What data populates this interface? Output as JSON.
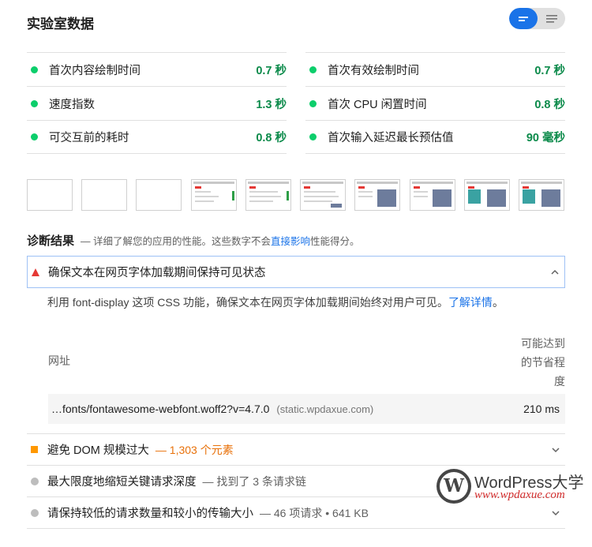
{
  "lab": {
    "title": "实验室数据",
    "view_toggle": {
      "active": "list-view-icon",
      "inactive": "text-view-icon"
    }
  },
  "metrics": {
    "left": [
      {
        "label": "首次内容绘制时间",
        "value": "0.7 秒",
        "status": "pass"
      },
      {
        "label": "速度指数",
        "value": "1.3 秒",
        "status": "pass"
      },
      {
        "label": "可交互前的耗时",
        "value": "0.8 秒",
        "status": "pass"
      }
    ],
    "right": [
      {
        "label": "首次有效绘制时间",
        "value": "0.7 秒",
        "status": "pass"
      },
      {
        "label": "首次 CPU 闲置时间",
        "value": "0.8 秒",
        "status": "pass"
      },
      {
        "label": "首次输入延迟最长预估值",
        "value": "90 毫秒",
        "status": "pass"
      }
    ],
    "colors": {
      "pass": "#0cce6b",
      "pass_text": "#0b8a4a",
      "warn": "#ff9800",
      "fail": "#e53935",
      "link": "#1a73e8"
    }
  },
  "filmstrip": {
    "frame_count": 10,
    "blank_frames": 3
  },
  "diagnostics": {
    "title": "诊断结果",
    "desc_prefix": "— 详细了解您的应用的性能。这些数字不会",
    "desc_link": "直接影响",
    "desc_suffix": "性能得分。",
    "open_audit": {
      "title": "确保文本在网页字体加载期间保持可见状态",
      "body_text": "利用 font-display 这项 CSS 功能，确保文本在网页字体加载期间始终对用户可见。",
      "body_link": "了解详情",
      "body_end": "。",
      "table": {
        "col_url": "网址",
        "col_savings": "可能达到的节省程度",
        "rows": [
          {
            "url": "…fonts/fontawesome-webfont.woff2?v=4.7.0",
            "host": "(static.wpdaxue.com)",
            "value": "210 ms"
          }
        ]
      }
    },
    "audits": [
      {
        "title": "避免 DOM 规模过大",
        "sub": "— 1,303 个元素",
        "kind": "warn"
      },
      {
        "title": "最大限度地缩短关键请求深度",
        "sub": "— 找到了 3 条请求链",
        "kind": "info"
      },
      {
        "title": "请保持较低的请求数量和较小的传输大小",
        "sub": "— 46 项请求 • 641 KB",
        "kind": "info"
      }
    ]
  },
  "watermark": {
    "name": "WordPress大学",
    "url": "www.wpdaxue.com",
    "logo_letter": "W"
  }
}
